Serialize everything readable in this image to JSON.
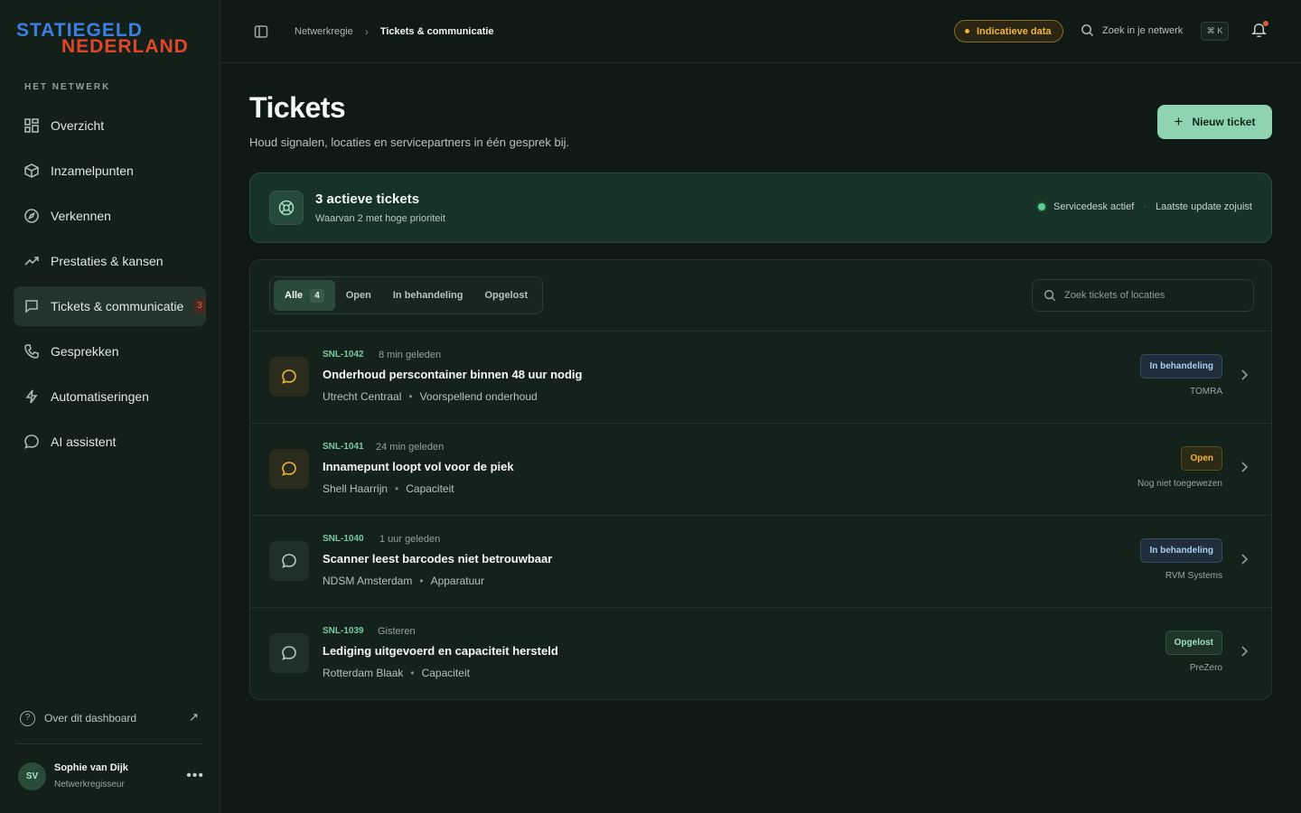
{
  "brand": {
    "line1": "STATIEGELD",
    "line2": "NEDERLAND"
  },
  "sidebar": {
    "section_label": "HET NETWERK",
    "items": [
      {
        "label": "Overzicht",
        "icon": "grid-icon"
      },
      {
        "label": "Inzamelpunten",
        "icon": "box-icon"
      },
      {
        "label": "Verkennen",
        "icon": "compass-icon"
      },
      {
        "label": "Prestaties & kansen",
        "icon": "trend-icon"
      },
      {
        "label": "Tickets & communicatie",
        "icon": "chat-icon",
        "badge": "3",
        "active": true
      },
      {
        "label": "Gesprekken",
        "icon": "phone-icon"
      },
      {
        "label": "Automatiseringen",
        "icon": "bolt-icon"
      },
      {
        "label": "AI assistent",
        "icon": "bubble-icon"
      }
    ],
    "about_label": "Over dit dashboard",
    "user": {
      "initials": "SV",
      "name": "Sophie van Dijk",
      "role": "Netwerkregisseur"
    }
  },
  "topbar": {
    "breadcrumb": [
      "Netwerkregie",
      "Tickets & communicatie"
    ],
    "data_pill": "Indicatieve data",
    "search_label": "Zoek in je netwerk",
    "shortcut": "⌘ K"
  },
  "main": {
    "title": "Tickets",
    "subtitle": "Houd signalen, locaties en servicepartners in één gesprek bij.",
    "new_button": "Nieuw ticket",
    "summary": {
      "title": "3 actieve tickets",
      "subtitle": "Waarvan 2 met hoge prioriteit",
      "status": "Servicedesk actief",
      "updated": "Laatste update zojuist"
    },
    "tabs": [
      {
        "label": "Alle",
        "count": "4",
        "active": true
      },
      {
        "label": "Open"
      },
      {
        "label": "In behandeling"
      },
      {
        "label": "Opgelost"
      }
    ],
    "search_placeholder": "Zoek tickets of locaties",
    "tickets": [
      {
        "id": "SNL-1042",
        "time": "8 min geleden",
        "title": "Onderhoud perscontainer binnen 48 uur nodig",
        "location": "Utrecht Centraal",
        "category": "Voorspellend onderhoud",
        "status": "In behandeling",
        "partner": "TOMRA"
      },
      {
        "id": "SNL-1041",
        "time": "24 min geleden",
        "title": "Innamepunt loopt vol voor de piek",
        "location": "Shell Haarrijn",
        "category": "Capaciteit",
        "status": "Open",
        "partner": "Nog niet toegewezen"
      },
      {
        "id": "SNL-1040",
        "time": "1 uur geleden",
        "title": "Scanner leest barcodes niet betrouwbaar",
        "location": "NDSM Amsterdam",
        "category": "Apparatuur",
        "status": "In behandeling",
        "partner": "RVM Systems"
      },
      {
        "id": "SNL-1039",
        "time": "Gisteren",
        "title": "Lediging uitgevoerd en capaciteit hersteld",
        "location": "Rotterdam Blaak",
        "category": "Capaciteit",
        "status": "Opgelost",
        "partner": "PreZero"
      }
    ]
  },
  "colors": {
    "accent": "#8fd3b0",
    "warning": "#f0b43c",
    "brand_blue": "#3d7fe0",
    "brand_red": "#e0462b"
  }
}
